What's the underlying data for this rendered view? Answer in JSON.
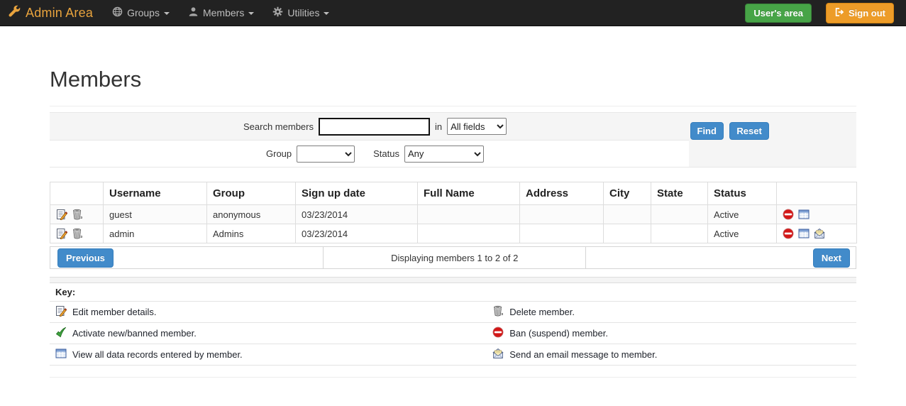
{
  "navbar": {
    "brand": "Admin Area",
    "items": [
      {
        "label": "Groups",
        "icon": "globe-icon"
      },
      {
        "label": "Members",
        "icon": "person-icon"
      },
      {
        "label": "Utilities",
        "icon": "gear-icon"
      }
    ],
    "users_area_label": "User's area",
    "sign_out_label": "Sign out"
  },
  "page": {
    "title": "Members"
  },
  "search": {
    "label": "Search members",
    "value": "",
    "in_label": "in",
    "fields_selected": "All fields",
    "group_label": "Group",
    "group_selected": "",
    "status_label": "Status",
    "status_selected": "Any",
    "find_label": "Find",
    "reset_label": "Reset"
  },
  "table": {
    "headers": {
      "icons": "",
      "username": "Username",
      "group": "Group",
      "signup": "Sign up date",
      "fullname": "Full Name",
      "address": "Address",
      "city": "City",
      "state": "State",
      "status": "Status",
      "actions": ""
    },
    "rows": [
      {
        "username": "guest",
        "group": "anonymous",
        "signup": "03/23/2014",
        "fullname": "",
        "address": "",
        "city": "",
        "state": "",
        "status": "Active"
      },
      {
        "username": "admin",
        "group": "Admins",
        "signup": "03/23/2014",
        "fullname": "",
        "address": "",
        "city": "",
        "state": "",
        "status": "Active"
      }
    ]
  },
  "pagination": {
    "previous_label": "Previous",
    "status_text": "Displaying members 1 to 2 of 2",
    "next_label": "Next"
  },
  "key": {
    "title": "Key:",
    "items": [
      {
        "icon": "edit-icon",
        "text": "Edit member details."
      },
      {
        "icon": "delete-icon",
        "text": "Delete member."
      },
      {
        "icon": "activate-icon",
        "text": "Activate new/banned member."
      },
      {
        "icon": "ban-icon",
        "text": "Ban (suspend) member."
      },
      {
        "icon": "records-icon",
        "text": "View all data records entered by member."
      },
      {
        "icon": "email-icon",
        "text": "Send an email message to member."
      }
    ]
  },
  "colors": {
    "navbar_bg": "#222222",
    "brand": "#e8a33d",
    "button_green": "#47a447",
    "button_orange": "#ed9c28",
    "button_blue": "#428bca",
    "ban_red": "#d41717",
    "check_green": "#3fa33f",
    "table_icon_blue": "#5c85c4"
  }
}
